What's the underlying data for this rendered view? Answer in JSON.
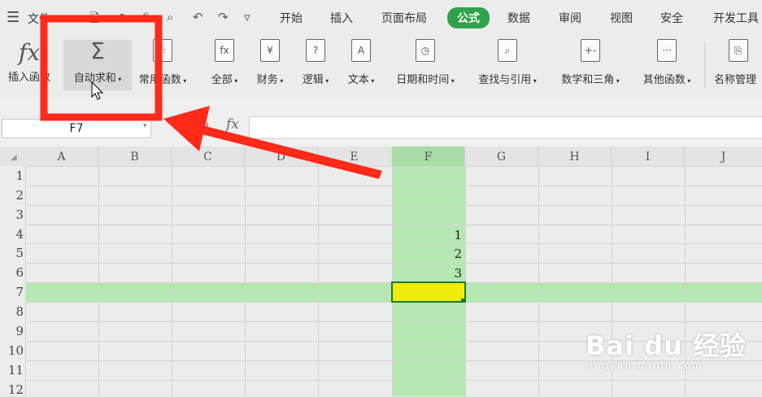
{
  "menu": {
    "file_label": "文件",
    "tabs": [
      {
        "label": "开始",
        "active": false
      },
      {
        "label": "插入",
        "active": false
      },
      {
        "label": "页面布局",
        "active": false
      },
      {
        "label": "公式",
        "active": true
      },
      {
        "label": "数据",
        "active": false
      },
      {
        "label": "审阅",
        "active": false
      },
      {
        "label": "视图",
        "active": false
      },
      {
        "label": "安全",
        "active": false
      },
      {
        "label": "开发工具",
        "active": false
      }
    ]
  },
  "ribbon": {
    "insert_function": "插入函数",
    "autosum": "自动求和",
    "common": "常用函数",
    "all": "全部",
    "finance": "财务",
    "logic": "逻辑",
    "text": "文本",
    "datetime": "日期和时间",
    "lookup": "查找与引用",
    "math": "数学和三角",
    "other": "其他函数",
    "name_manager": "名称管理",
    "icons": {
      "insert_function": "fx",
      "autosum": "Σ",
      "all": "fx",
      "finance": "¥",
      "logic": "?",
      "text": "A",
      "datetime": "◷",
      "lookup": "⌕",
      "math": "+-",
      "other": "···"
    }
  },
  "formula_bar": {
    "name_box": "F7",
    "fx_label": "fx",
    "formula": ""
  },
  "grid": {
    "columns": [
      "A",
      "B",
      "C",
      "D",
      "E",
      "F",
      "G",
      "H",
      "I",
      "J"
    ],
    "rows": [
      "1",
      "2",
      "3",
      "4",
      "5",
      "6",
      "7",
      "8",
      "9",
      "10",
      "11",
      "12"
    ],
    "cells": {
      "F4": "1",
      "F5": "2",
      "F6": "3"
    },
    "active_cell": "F7",
    "highlight_color": "#b5e8b3",
    "active_fill": "#f0ec0c"
  },
  "watermark": {
    "logo": "Bai du 经验",
    "url": "jingyan.baidu.com"
  }
}
